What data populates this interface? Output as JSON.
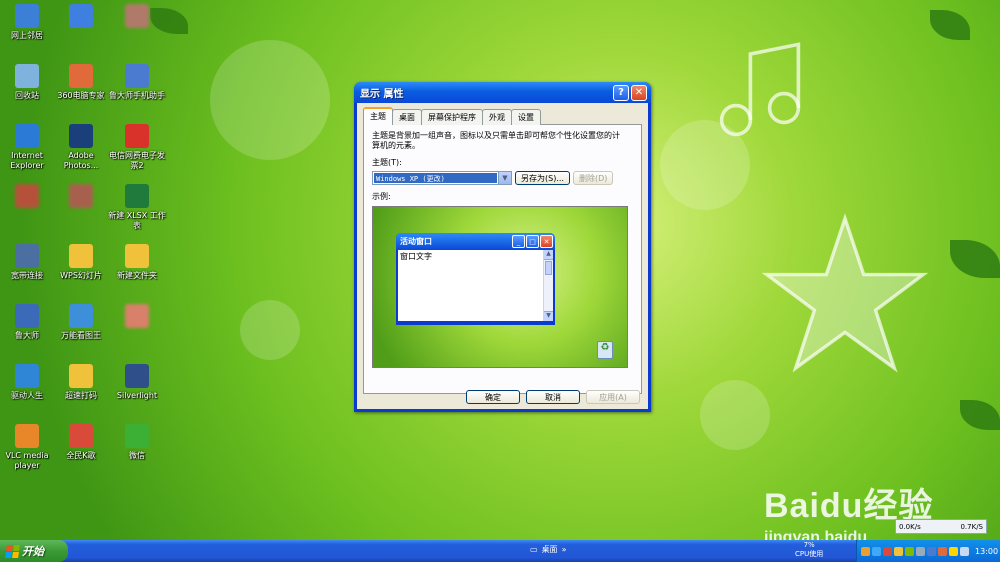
{
  "desktop": {
    "icons": [
      {
        "label": "网上邻居",
        "icon": "network-icon",
        "color": "#3b7fd6"
      },
      {
        "label": "",
        "icon": "baidu-netdisk-icon",
        "color": "#3f7fe0"
      },
      {
        "label": "",
        "icon": "blurred-icon",
        "color": "#b07a6a"
      },
      {
        "label": "回收站",
        "icon": "recycle-bin-icon",
        "color": "#7fb3dd"
      },
      {
        "label": "360电脑专家",
        "icon": "360-expert-icon",
        "color": "#e06a3a"
      },
      {
        "label": "鲁大师手机助手",
        "icon": "ludashi-phone-icon",
        "color": "#4a7bd0"
      },
      {
        "label": "Internet Explorer",
        "icon": "ie-icon",
        "color": "#2b7ad6"
      },
      {
        "label": "Adobe Photos...",
        "icon": "photoshop-icon",
        "color": "#1b3f7a"
      },
      {
        "label": "电信网费电子发票2",
        "icon": "pdf-icon",
        "color": "#d9322b"
      },
      {
        "label": "",
        "icon": "blurred-icon",
        "color": "#b5513b"
      },
      {
        "label": "",
        "icon": "blurred-icon",
        "color": "#a8604e"
      },
      {
        "label": "新建 XLSX 工作表",
        "icon": "xlsx-icon",
        "color": "#1f7a3c"
      },
      {
        "label": "宽带连接",
        "icon": "broadband-icon",
        "color": "#4a6fa0"
      },
      {
        "label": "WPS幻灯片",
        "icon": "folder-icon",
        "color": "#f0c23c"
      },
      {
        "label": "新建文件夹",
        "icon": "folder-icon",
        "color": "#f0c23c"
      },
      {
        "label": "鲁大师",
        "icon": "ludashi-icon",
        "color": "#3a6ab8"
      },
      {
        "label": "万能看图王",
        "icon": "image-viewer-icon",
        "color": "#3e8fd9"
      },
      {
        "label": "",
        "icon": "blurred-icon",
        "color": "#d9806b"
      },
      {
        "label": "驱动人生",
        "icon": "driver-icon",
        "color": "#2f86d6"
      },
      {
        "label": "超速打码",
        "icon": "folder-icon",
        "color": "#f0c23c"
      },
      {
        "label": "Silverlight",
        "icon": "silverlight-icon",
        "color": "#2f4f8a"
      },
      {
        "label": "VLC media player",
        "icon": "vlc-icon",
        "color": "#e8862a"
      },
      {
        "label": "全民K歌",
        "icon": "kge-icon",
        "color": "#d94a3a"
      },
      {
        "label": "微信",
        "icon": "wechat-icon",
        "color": "#3cb034"
      }
    ]
  },
  "dialog": {
    "title": "显示 属性",
    "tabs": [
      "主题",
      "桌面",
      "屏幕保护程序",
      "外观",
      "设置"
    ],
    "active_tab": "主题",
    "description": "主题是背景加一组声音，图标以及只需单击即可帮您个性化设置您的计算机的元素。",
    "theme_label": "主题(T):",
    "theme_value": "Windows XP (更改)",
    "save_as": "另存为(S)...",
    "delete": "删除(D)",
    "preview_label": "示例:",
    "preview_window_title": "活动窗口",
    "preview_window_text": "窗口文字",
    "ok": "确定",
    "cancel": "取消",
    "apply": "应用(A)"
  },
  "taskbar": {
    "start": "开始",
    "desktop_label": "桌面",
    "chevron": "»",
    "cpu_percent": "7%",
    "cpu_label": "CPU使用",
    "clock": "13:00"
  },
  "net_widget": {
    "up": "0.0K/s",
    "down": "0.7K/S"
  },
  "watermark": {
    "brand": "Baidu经验",
    "url": "jingyan.baidu"
  }
}
